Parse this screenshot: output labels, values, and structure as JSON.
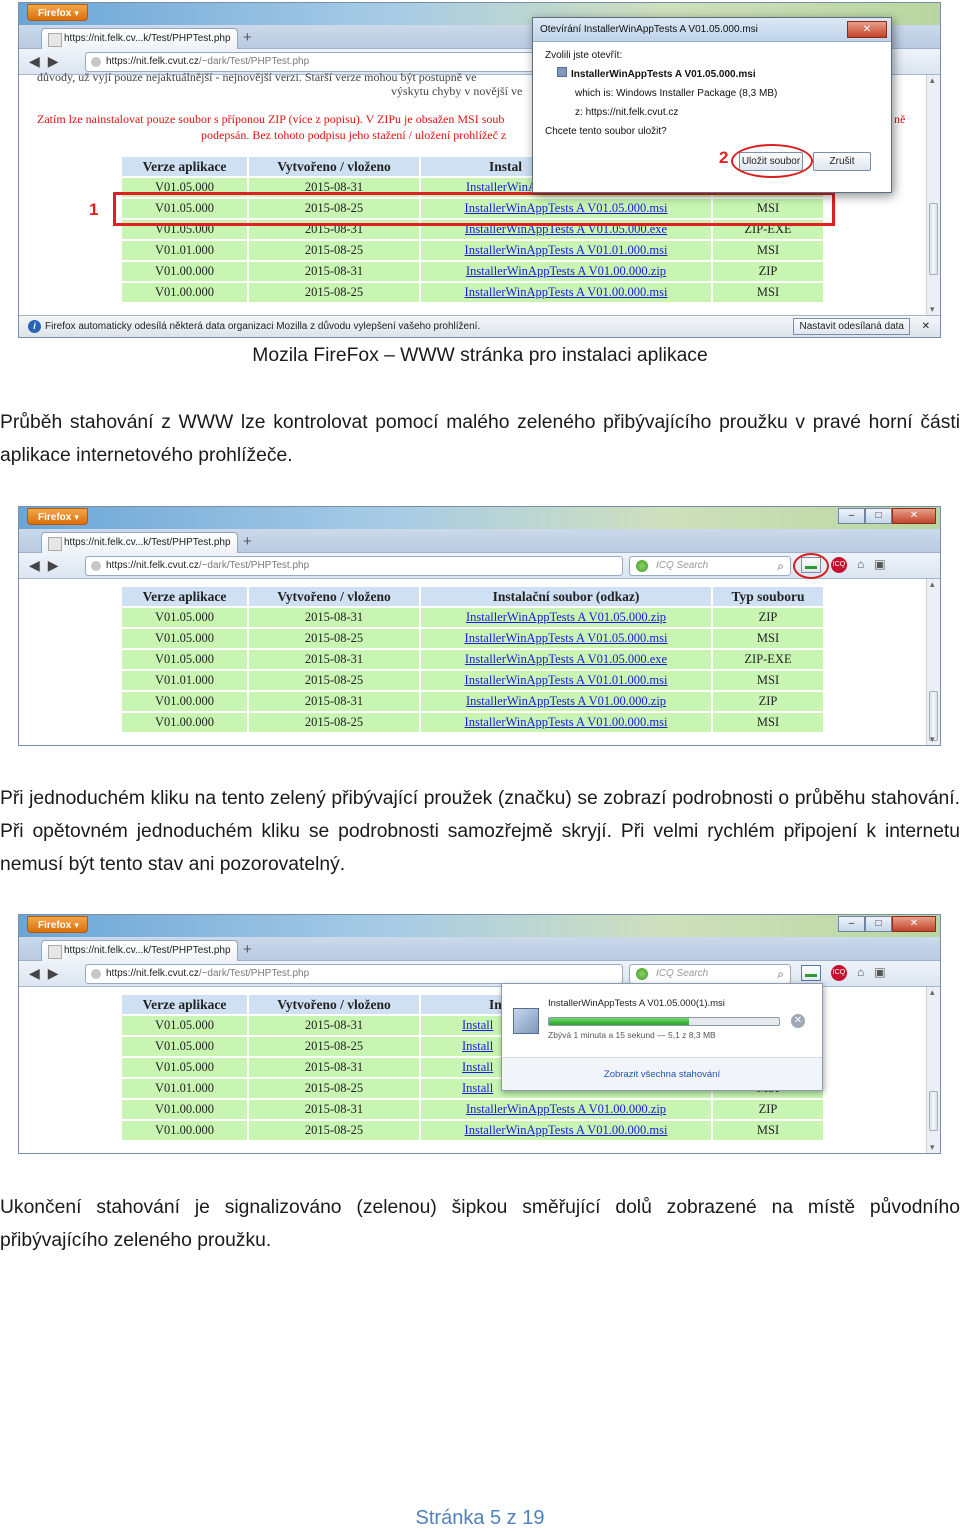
{
  "browser": {
    "menu_label": "Firefox",
    "tab_label": "https://nit.felk.cv...k/Test/PHPTest.php",
    "tab_plus": "+",
    "url_host": "https://nit.felk.cvut.cz",
    "url_path": "/~dark/Test/PHPTest.php",
    "search_placeholder": "ICQ Search",
    "minimize": "–",
    "maximize": "□",
    "close": "✕"
  },
  "table": {
    "headers": [
      "Verze aplikace",
      "Vytvořeno / vloženo",
      "Instalační soubor (odkaz)",
      "Typ souboru"
    ],
    "header_short": "Instal",
    "header_short3": "In",
    "rows": [
      [
        "V01.05.000",
        "2015-08-31",
        "InstallerWinAppTests A V01.05.000.zip",
        "ZIP"
      ],
      [
        "V01.05.000",
        "2015-08-25",
        "InstallerWinAppTests A V01.05.000.msi",
        "MSI"
      ],
      [
        "V01.05.000",
        "2015-08-31",
        "InstallerWinAppTests A V01.05.000.exe",
        "ZIP-EXE"
      ],
      [
        "V01.01.000",
        "2015-08-25",
        "InstallerWinAppTests A V01.01.000.msi",
        "MSI"
      ],
      [
        "V01.00.000",
        "2015-08-31",
        "InstallerWinAppTests A V01.00.000.zip",
        "ZIP"
      ],
      [
        "V01.00.000",
        "2015-08-25",
        "InstallerWinAppTests A V01.00.000.msi",
        "MSI"
      ]
    ],
    "link_short": "Install"
  },
  "shot1": {
    "top_text": "důvody, už vyjí pouze nejaktuálnější - nejnovější verzi. Starší verze mohou být postupně ve",
    "top_text2": "výskytu chyby v novější ve",
    "red_line1": "Zatím lze nainstalovat pouze soubor s příponou ZIP (více z popisu). V ZIPu je obsažen MSI soub",
    "red_line2": "podepsán. Bez tohoto podpisu jeho stažení / uložení prohlížeč z",
    "red_line2b": "ně",
    "dialog_title": "Otevírání InstallerWinAppTests A V01.05.000.msi",
    "dialog_close": "✕",
    "dialog_open_label": "Zvolili jste otevřít:",
    "dialog_file": "InstallerWinAppTests A V01.05.000.msi",
    "dialog_which_label": "which is:",
    "dialog_which": "Windows Installer Package (8,3 MB)",
    "dialog_from_label": "z:",
    "dialog_from": "https://nit.felk.cvut.cz",
    "dialog_question": "Chcete tento soubor uložit?",
    "save_button": "Uložit soubor",
    "cancel_button": "Zrušit",
    "label_1": "1",
    "label_2": "2",
    "notif_text": "Firefox automaticky odesílá některá data organizaci Mozilla z důvodu vylepšení vašeho prohlížení.",
    "notif_button": "Nastavit odesílaná data",
    "notif_close": "✕"
  },
  "shot3": {
    "popup_file": "InstallerWinAppTests A V01.05.000(1).msi",
    "popup_status": "Zbývá 1 minuta a 15 sekund — 5,1 z 8,3 MB",
    "popup_show_all": "Zobrazit všechna stahování",
    "progress_fraction": 0.61
  },
  "text": {
    "caption1": "Mozila FireFox – WWW stránka pro instalaci aplikace",
    "para1": "Průběh stahování z WWW lze kontrolovat pomocí malého zeleného přibývajícího proužku v pravé horní části aplikace internetového prohlížeče.",
    "para2": "Při jednoduchém kliku na tento zelený přibývající proužek (značku) se zobrazí podrobnosti o průběhu stahování. Při opětovném jednoduchém kliku se podrobnosti samozřejmě skryjí. Při velmi rychlém připojení k internetu nemusí být tento stav ani pozorovatelný.",
    "para3": "Ukončení stahování je signalizováno (zelenou) šipkou směřující dolů zobrazené na místě původního přibývajícího zeleného proužku.",
    "footer": "Stránka 5 z 19"
  },
  "colors": {
    "row_green": "#c8f6b2",
    "header_blue": "#cfe0f3",
    "annotation_red": "#e02020",
    "footer_blue": "#4f81bd"
  }
}
